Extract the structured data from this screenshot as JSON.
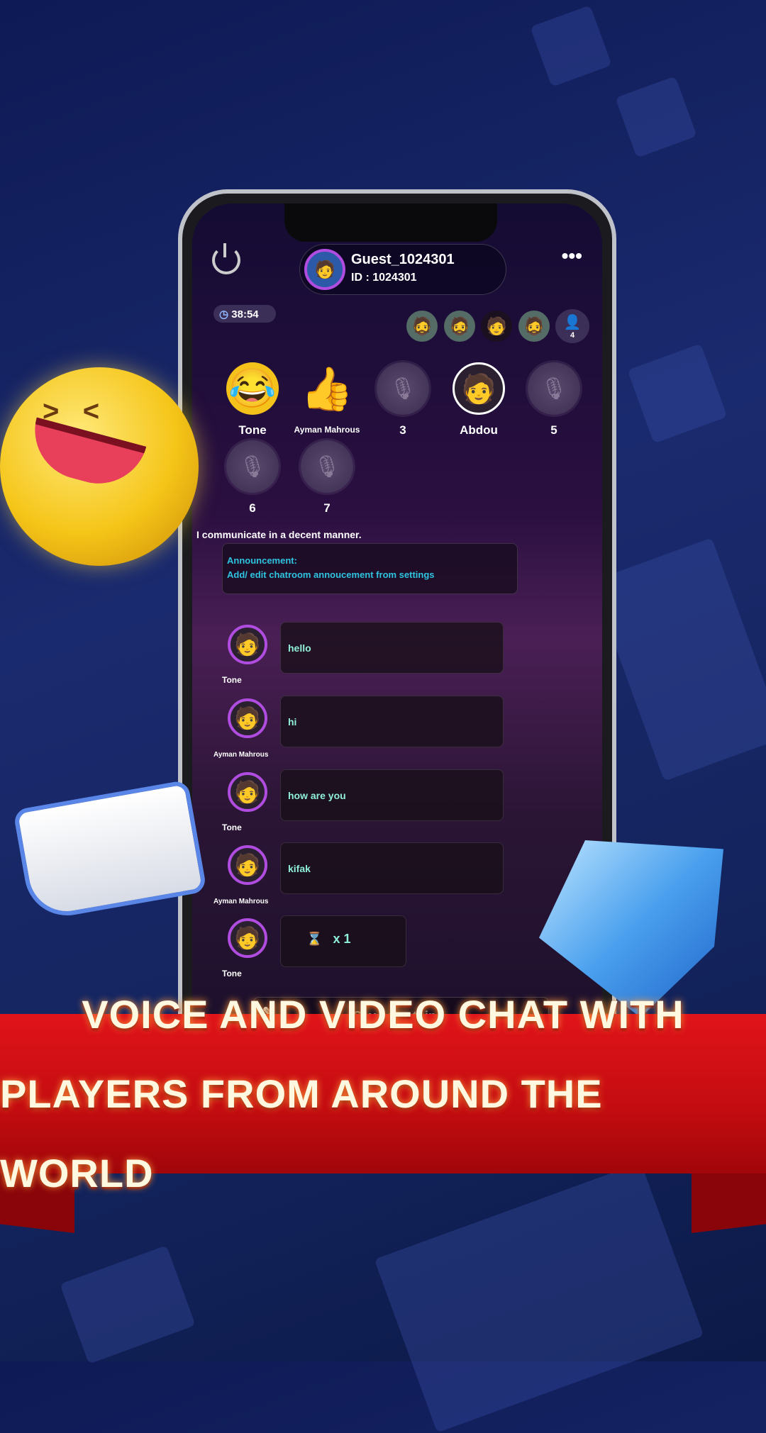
{
  "header": {
    "username": "Guest_1024301",
    "user_id": "ID : 1024301",
    "timer": "38:54",
    "audience_count": "4"
  },
  "seats": [
    {
      "label": "Tone",
      "type": "emoji",
      "icon": "crying-laughing-emoji"
    },
    {
      "label": "Ayman Mahrous",
      "type": "emoji",
      "icon": "thumbs-up-emoji"
    },
    {
      "label": "3",
      "type": "empty",
      "icon": "mic-icon"
    },
    {
      "label": "Abdou",
      "type": "avatar",
      "icon": "avatar"
    },
    {
      "label": "5",
      "type": "empty",
      "icon": "mic-icon"
    },
    {
      "label": "6",
      "type": "empty",
      "icon": "mic-icon"
    },
    {
      "label": "7",
      "type": "empty",
      "icon": "mic-icon"
    }
  ],
  "rule_text": "I communicate in a decent manner.",
  "announcement": {
    "title": "Announcement:",
    "body": "Add/ edit chatroom annoucement from settings"
  },
  "messages": [
    {
      "sender": "Tone",
      "text": "hello"
    },
    {
      "sender": "Ayman Mahrous",
      "text": "hi"
    },
    {
      "sender": "Tone",
      "text": "how are you"
    },
    {
      "sender": "Ayman Mahrous",
      "text": "kifak"
    },
    {
      "sender": "Tone",
      "text": "x 1",
      "gift": "hourglass-icon"
    }
  ],
  "input": {
    "placeholder": "Say something"
  },
  "banner": {
    "line1": "VOICE AND VIDEO CHAT WITH",
    "line2": "PLAYERS FROM AROUND THE WORLD"
  },
  "colors": {
    "accent": "#8ff0d8",
    "announcement": "#2ec4e0",
    "banner": "#d8101a",
    "avatar_ring": "#b04de0"
  }
}
